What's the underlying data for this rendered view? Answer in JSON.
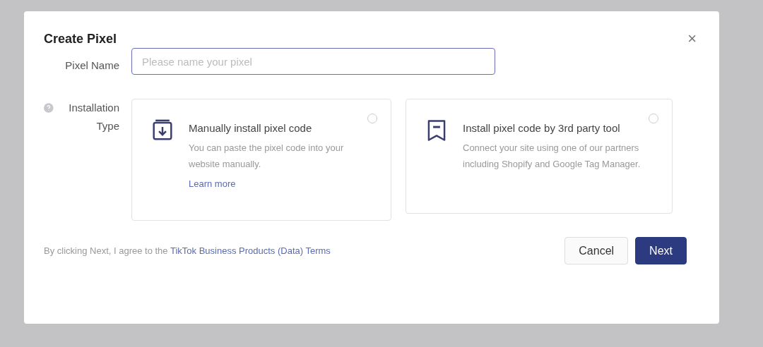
{
  "dialog": {
    "title": "Create Pixel",
    "close": "×"
  },
  "pixel_name": {
    "label": "Pixel Name",
    "placeholder": "Please name your pixel"
  },
  "installation_type": {
    "label": "Installation Type",
    "options": [
      {
        "kind": "manual",
        "title": "Manually install pixel code",
        "description": "You can paste the pixel code into your website manually.",
        "link": "Learn more",
        "selected": false
      },
      {
        "kind": "partner",
        "title": "Install pixel code by 3rd party tool",
        "description": "Connect your site using one of our partners including Shopify and Google Tag Manager.",
        "selected": false
      }
    ]
  },
  "footer": {
    "terms_prefix": "By clicking Next, I agree to the",
    "terms_link": "TikTok Business Products (Data) Terms",
    "buttons": [
      {
        "kind": "secondary",
        "label": "Cancel"
      },
      {
        "kind": "primary",
        "label": "Next"
      }
    ]
  }
}
